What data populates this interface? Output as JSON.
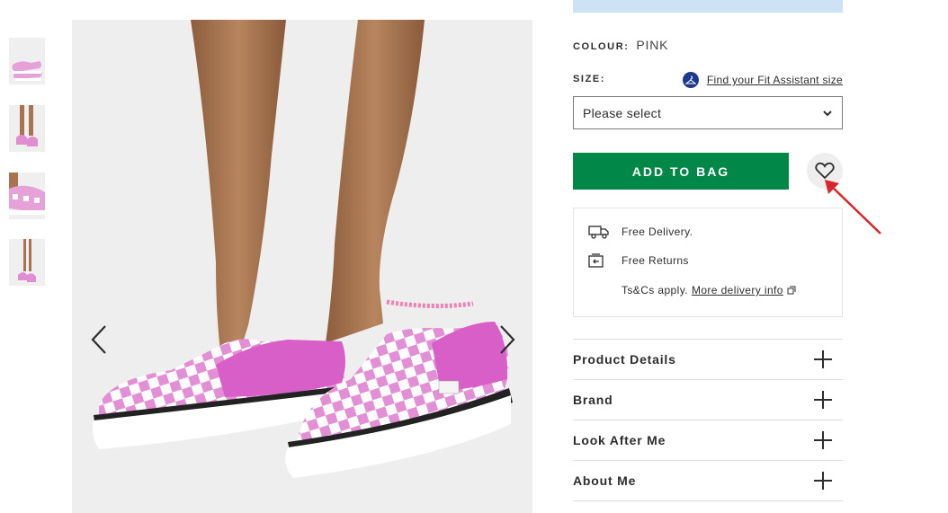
{
  "gallery": {
    "thumbnails": [
      {
        "name": "thumbnail-1-side-pair"
      },
      {
        "name": "thumbnail-2-on-foot"
      },
      {
        "name": "thumbnail-3-closeup"
      },
      {
        "name": "thumbnail-4-model"
      }
    ],
    "prev_icon": "chevron-left-icon",
    "next_icon": "chevron-right-icon"
  },
  "product": {
    "colour_label": "COLOUR:",
    "colour_value": "PINK",
    "size_label": "SIZE:",
    "fit_assistant_link": "Find your Fit Assistant size",
    "size_select_value": "Please select",
    "add_to_bag_label": "ADD TO BAG",
    "save_icon": "heart-icon"
  },
  "delivery": {
    "free_delivery": "Free Delivery.",
    "free_returns": "Free Returns",
    "terms_prefix": "Ts&Cs apply.",
    "more_info_link": "More delivery info"
  },
  "accordion": {
    "items": [
      {
        "label": "Product Details"
      },
      {
        "label": "Brand"
      },
      {
        "label": "Look After Me"
      },
      {
        "label": "About Me"
      }
    ]
  },
  "colors": {
    "add_to_bag_bg": "#018849",
    "banner_bg": "#cde2f5",
    "fit_icon_bg": "#1f3a8a",
    "annotation_arrow": "#d9262b"
  }
}
